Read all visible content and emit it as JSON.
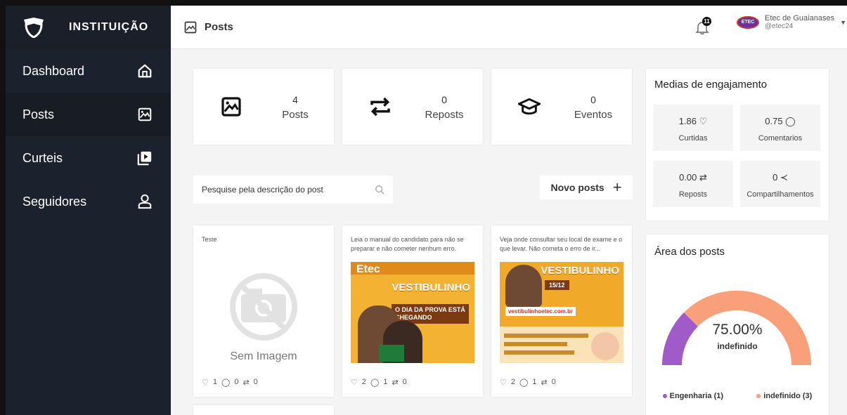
{
  "brand": {
    "name": "INSTITUIÇÃO"
  },
  "sidebar": {
    "items": [
      {
        "label": "Dashboard",
        "icon": "home-icon"
      },
      {
        "label": "Posts",
        "icon": "image-icon",
        "active": true
      },
      {
        "label": "Curteis",
        "icon": "video-icon"
      },
      {
        "label": "Seguidores",
        "icon": "user-icon"
      }
    ]
  },
  "header": {
    "title": "Posts",
    "notifications": "11",
    "profile_name": "Etec de Guaianases",
    "profile_handle": "@etec24"
  },
  "stats": [
    {
      "value": "4",
      "label": "Posts",
      "icon": "image-icon"
    },
    {
      "value": "0",
      "label": "Reposts",
      "icon": "repost-icon"
    },
    {
      "value": "0",
      "label": "Eventos",
      "icon": "graduation-cap-icon"
    }
  ],
  "search": {
    "placeholder": "Pesquise pela descrição do post"
  },
  "new_post": {
    "label": "Novo posts"
  },
  "posts": [
    {
      "desc": "Teste",
      "image": "Sem Imagem",
      "likes": "1",
      "comments": "0",
      "reposts": "0"
    },
    {
      "desc": "Leia o manual do candidato para não se preparar e não cometer nenhum erro.",
      "likes": "2",
      "comments": "1",
      "reposts": "0",
      "flyer": {
        "brand": "Etec",
        "headline": "VESTIBULINHO",
        "box": "O DIA DA PROVA ESTÁ CHEGANDO"
      }
    },
    {
      "desc": "Veja onde consultar seu local de exame e o que levar. Não cometa o erro de ir...",
      "likes": "2",
      "comments": "1",
      "reposts": "0",
      "flyer": {
        "headline": "VESTIBULINHO",
        "date": "15/12",
        "url": "vestibulinhoetec.com.br"
      }
    }
  ],
  "engagement": {
    "title": "Medias de engajamento",
    "items": [
      {
        "value": "1.86 ♡",
        "label": "Curtidas"
      },
      {
        "value": "0.75 ◯",
        "label": "Comentarios"
      },
      {
        "value": "0.00 ⇄",
        "label": "Reposts"
      },
      {
        "value": "0 ≺",
        "label": "Compartilhamentos"
      }
    ]
  },
  "area": {
    "title": "Área dos posts",
    "percent": "75.00%",
    "center_label": "indefinido",
    "legend": [
      {
        "label": "Engenharia (1)",
        "color": "#a05bc8"
      },
      {
        "label": "indefinido (3)",
        "color": "#f9a07a"
      }
    ]
  },
  "chart_data": {
    "type": "pie",
    "categories": [
      "Engenharia",
      "indefinido"
    ],
    "values": [
      1,
      3
    ],
    "title": "Área dos posts"
  }
}
